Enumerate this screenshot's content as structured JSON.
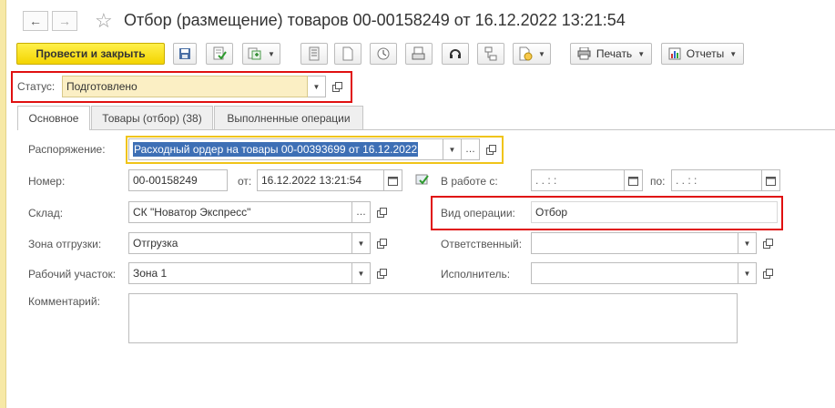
{
  "window": {
    "title": "Отбор (размещение) товаров 00-00158249 от 16.12.2022 13:21:54"
  },
  "toolbar": {
    "post_and_close": "Провести и закрыть",
    "print": "Печать",
    "reports": "Отчеты"
  },
  "status": {
    "label": "Статус:",
    "value": "Подготовлено"
  },
  "tabs": [
    {
      "label": "Основное"
    },
    {
      "label": "Товары (отбор) (38)"
    },
    {
      "label": "Выполненные операции"
    }
  ],
  "form": {
    "order_label": "Распоряжение:",
    "order_value": "Расходный ордер на товары 00-00393699 от 16.12.2022",
    "number_label": "Номер:",
    "number_value": "00-00158249",
    "from_label": "от:",
    "date_value": "16.12.2022 13:21:54",
    "in_work_label": "В работе с:",
    "in_work_value": " .  .       :  :",
    "to_label": "по:",
    "to_value": " .  .       :  :",
    "warehouse_label": "Склад:",
    "warehouse_value": "СК \"Новатор Экспресс\"",
    "operation_label": "Вид операции:",
    "operation_value": "Отбор",
    "zone_label": "Зона отгрузки:",
    "zone_value": "Отгрузка",
    "responsible_label": "Ответственный:",
    "responsible_value": "",
    "workplace_label": "Рабочий участок:",
    "workplace_value": "Зона 1",
    "executor_label": "Исполнитель:",
    "executor_value": "",
    "comment_label": "Комментарий:",
    "comment_value": ""
  },
  "colors": {
    "primary_button": "#f3d400",
    "highlight_box": "#e01010",
    "status_field_bg": "#fbefc4",
    "selection": "#3d6fb5",
    "focus_border": "#f0c419"
  }
}
